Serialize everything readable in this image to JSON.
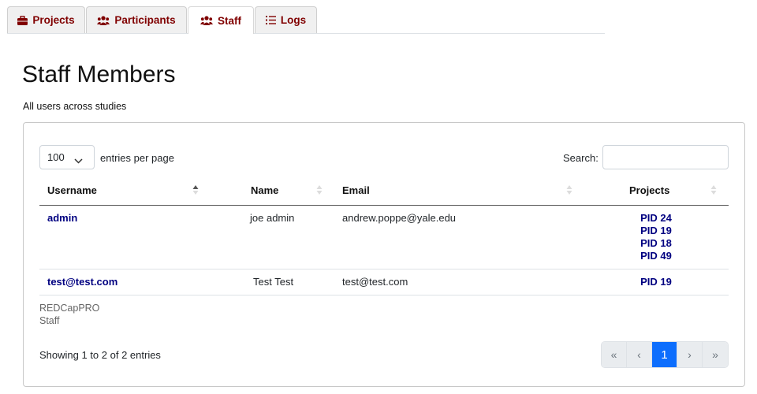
{
  "tabs": [
    {
      "label": "Projects",
      "icon": "briefcase-icon",
      "active": false
    },
    {
      "label": "Participants",
      "icon": "users-icon",
      "active": false
    },
    {
      "label": "Staff",
      "icon": "users-icon",
      "active": true
    },
    {
      "label": "Logs",
      "icon": "list-icon",
      "active": false
    }
  ],
  "colors": {
    "tab_text": "#800000",
    "link": "#000080",
    "pager_active": "#0d6efd"
  },
  "page_title": "Staff Members",
  "subtitle": "All users across studies",
  "table_controls": {
    "length_value": "100",
    "length_label": "entries per page",
    "search_label": "Search:",
    "search_value": ""
  },
  "columns": [
    "Username",
    "Name",
    "Email",
    "Projects"
  ],
  "rows": [
    {
      "username": "admin",
      "name": "joe admin",
      "email": "andrew.poppe@yale.edu",
      "projects": [
        "PID 24",
        "PID 19",
        "PID 18",
        "PID 49"
      ]
    },
    {
      "username": "test@test.com",
      "name": "Test Test",
      "email": "test@test.com",
      "projects": [
        "PID 19"
      ]
    }
  ],
  "footer": {
    "line1": "REDCapPRO",
    "line2": "Staff"
  },
  "showing": "Showing 1 to 2 of 2 entries",
  "pagination": {
    "first": "«",
    "prev": "‹",
    "current": "1",
    "next": "›",
    "last": "»"
  }
}
